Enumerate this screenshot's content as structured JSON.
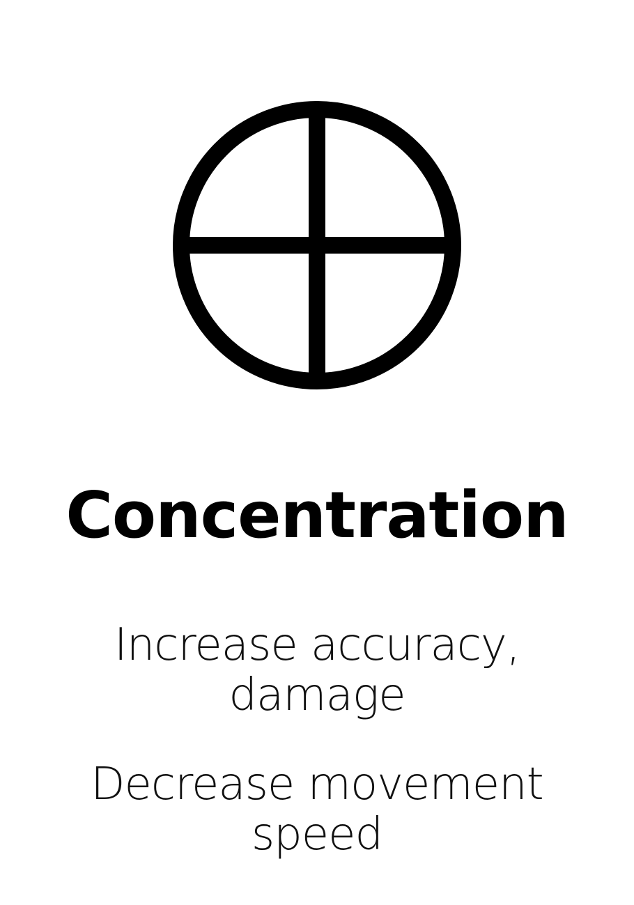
{
  "card": {
    "symbol_icon": "circle-cross-icon",
    "title": "Concentration",
    "effects": {
      "increase": [
        "Increase accuracy,",
        "damage"
      ],
      "decrease": [
        "Decrease movement",
        "speed"
      ]
    }
  }
}
